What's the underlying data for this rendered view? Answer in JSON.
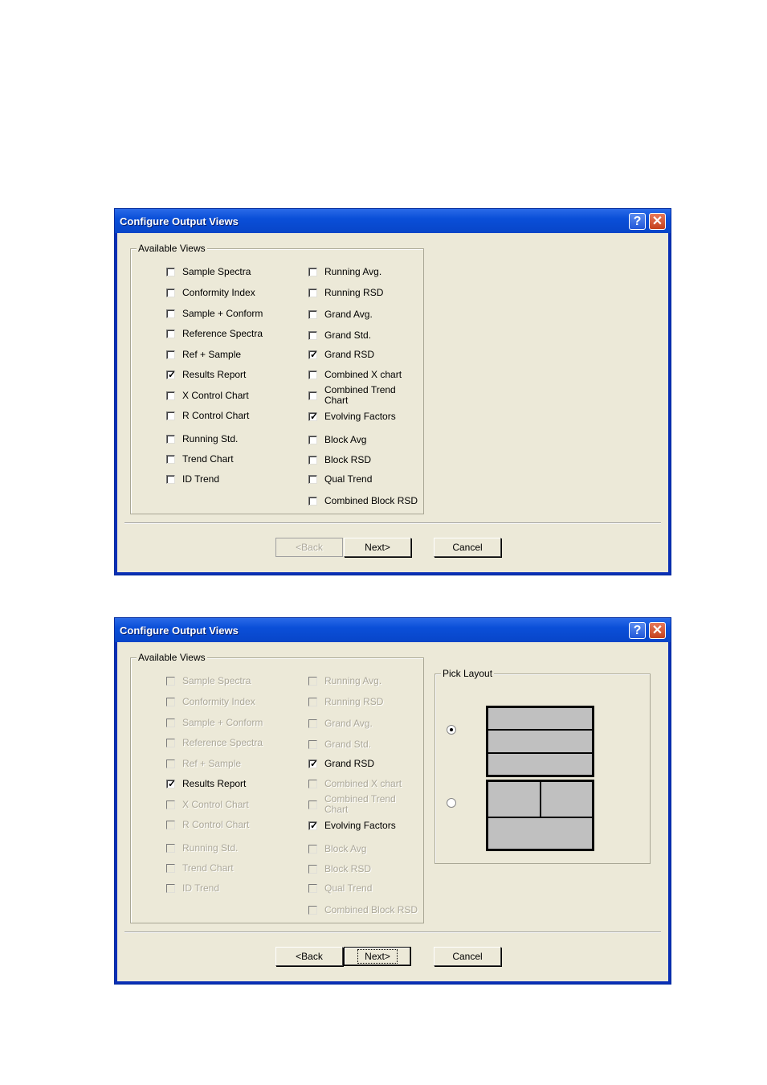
{
  "dialog1": {
    "title": "Configure Output Views",
    "help_glyph": "?",
    "close_glyph": "✕",
    "group_label": "Available Views",
    "left_items": [
      {
        "label": "Sample Spectra",
        "checked": false
      },
      {
        "label": "Conformity Index",
        "checked": false
      },
      {
        "label": "Sample + Conform",
        "checked": false
      },
      {
        "label": "Reference Spectra",
        "checked": false
      },
      {
        "label": "Ref + Sample",
        "checked": false
      },
      {
        "label": "Results Report",
        "checked": true
      },
      {
        "label": "X Control Chart",
        "checked": false
      },
      {
        "label": "R Control Chart",
        "checked": false
      },
      {
        "label": "Running Std.",
        "checked": false
      },
      {
        "label": "Trend Chart",
        "checked": false
      },
      {
        "label": "ID Trend",
        "checked": false
      }
    ],
    "right_items": [
      {
        "label": "Running Avg.",
        "checked": false
      },
      {
        "label": "Running RSD",
        "checked": false
      },
      {
        "label": "Grand Avg.",
        "checked": false
      },
      {
        "label": "Grand Std.",
        "checked": false
      },
      {
        "label": "Grand RSD",
        "checked": true
      },
      {
        "label": "Combined X chart",
        "checked": false
      },
      {
        "label": "Combined Trend Chart",
        "checked": false
      },
      {
        "label": "Evolving Factors",
        "checked": true
      },
      {
        "label": "Block Avg",
        "checked": false
      },
      {
        "label": "Block RSD",
        "checked": false
      },
      {
        "label": "Qual Trend",
        "checked": false
      },
      {
        "label": "Combined Block RSD",
        "checked": false
      }
    ],
    "buttons": {
      "back": "<Back",
      "next": "Next>",
      "cancel": "Cancel"
    }
  },
  "dialog2": {
    "title": "Configure Output Views",
    "help_glyph": "?",
    "close_glyph": "✕",
    "group_label": "Available Views",
    "left_items": [
      {
        "label": "Sample Spectra",
        "checked": false,
        "enabled": false
      },
      {
        "label": "Conformity Index",
        "checked": false,
        "enabled": false
      },
      {
        "label": "Sample + Conform",
        "checked": false,
        "enabled": false
      },
      {
        "label": "Reference Spectra",
        "checked": false,
        "enabled": false
      },
      {
        "label": "Ref + Sample",
        "checked": false,
        "enabled": false
      },
      {
        "label": "Results Report",
        "checked": true,
        "enabled": true
      },
      {
        "label": "X Control Chart",
        "checked": false,
        "enabled": false
      },
      {
        "label": "R Control Chart",
        "checked": false,
        "enabled": false
      },
      {
        "label": "Running Std.",
        "checked": false,
        "enabled": false
      },
      {
        "label": "Trend Chart",
        "checked": false,
        "enabled": false
      },
      {
        "label": "ID Trend",
        "checked": false,
        "enabled": false
      }
    ],
    "right_items": [
      {
        "label": "Running Avg.",
        "checked": false,
        "enabled": false
      },
      {
        "label": "Running RSD",
        "checked": false,
        "enabled": false
      },
      {
        "label": "Grand Avg.",
        "checked": false,
        "enabled": false
      },
      {
        "label": "Grand Std.",
        "checked": false,
        "enabled": false
      },
      {
        "label": "Grand RSD",
        "checked": true,
        "enabled": true
      },
      {
        "label": "Combined X chart",
        "checked": false,
        "enabled": false
      },
      {
        "label": "Combined Trend Chart",
        "checked": false,
        "enabled": false
      },
      {
        "label": "Evolving Factors",
        "checked": true,
        "enabled": true
      },
      {
        "label": "Block Avg",
        "checked": false,
        "enabled": false
      },
      {
        "label": "Block RSD",
        "checked": false,
        "enabled": false
      },
      {
        "label": "Qual Trend",
        "checked": false,
        "enabled": false
      },
      {
        "label": "Combined Block RSD",
        "checked": false,
        "enabled": false
      }
    ],
    "layout_group_label": "Pick Layout",
    "layout_options": [
      {
        "name": "three-rows",
        "selected": true
      },
      {
        "name": "two-top-one-bottom",
        "selected": false
      }
    ],
    "buttons": {
      "back": "<Back",
      "next": "Next>",
      "cancel": "Cancel"
    }
  }
}
